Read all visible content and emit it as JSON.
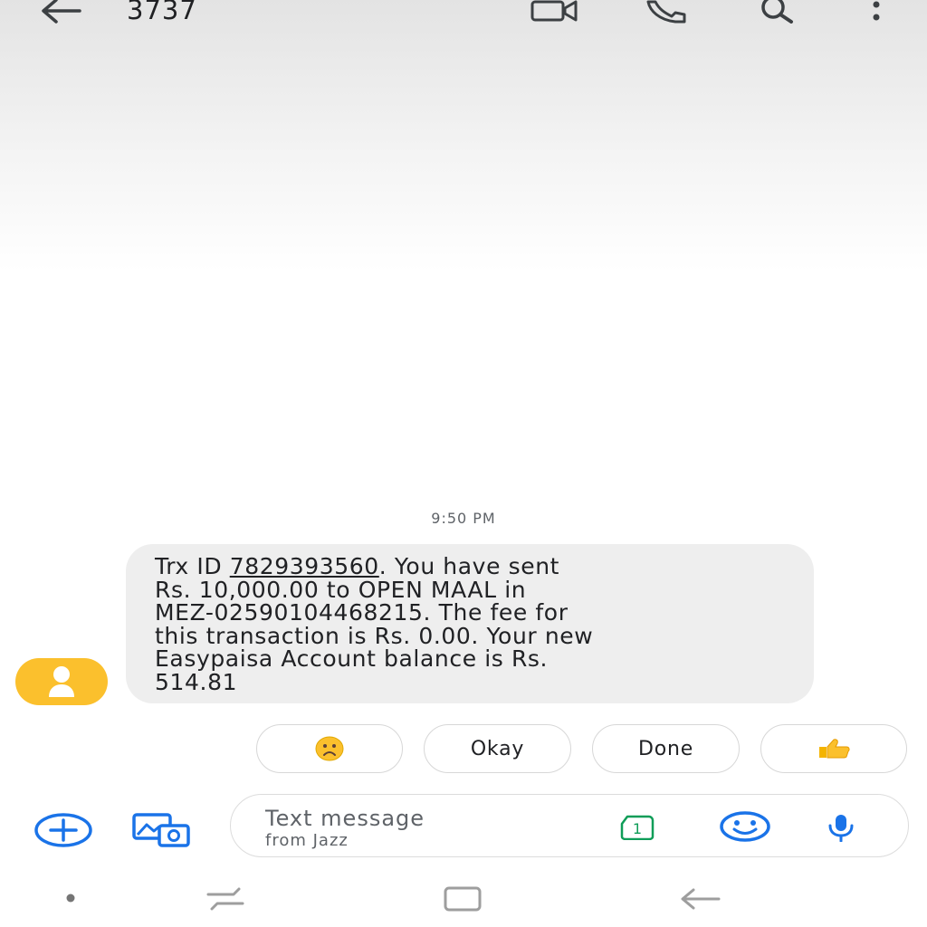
{
  "header": {
    "title": "3737",
    "icons": [
      "back-arrow-icon",
      "video-call-icon",
      "phone-icon",
      "search-icon",
      "more-vert-icon"
    ]
  },
  "conversation": {
    "timestamp": "9:50 PM",
    "message": {
      "lines": [
        "Trx ID ",
        "Rs. 10,000.00 to OPEN MAAL in",
        "MEZ-02590104468215. The fee for",
        "this transaction is Rs. 0.00. Your new",
        "Easypaisa Account balance is Rs.",
        "514.81"
      ],
      "trx_id": "7829393560",
      "line1_suffix": ". You have sent"
    }
  },
  "smart_replies": [
    {
      "icon": "frowning-face-emoji"
    },
    {
      "label": "Okay"
    },
    {
      "label": "Done"
    },
    {
      "icon": "thumbs-up-emoji"
    }
  ],
  "composer": {
    "placeholder_line1": "Text message",
    "placeholder_line2": "from Jazz",
    "sim_number": "1"
  },
  "colors": {
    "accent_blue": "#1a73e8",
    "avatar_yellow": "#fbc02d",
    "sim_green": "#0f9d58",
    "bubble_gray": "#eeeeee"
  }
}
